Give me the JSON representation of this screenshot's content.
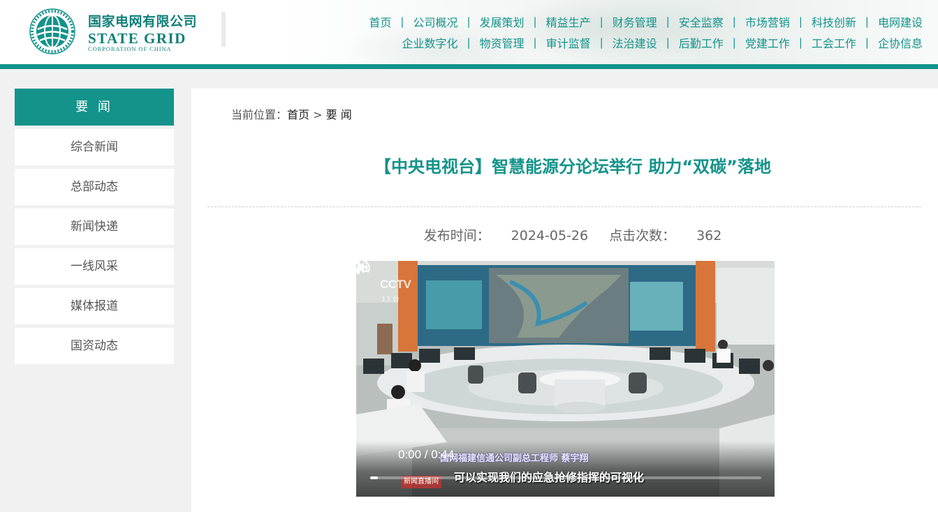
{
  "brand": {
    "name_cn": "国家电网有限公司",
    "name_en": "STATE GRID",
    "name_en_sub": "CORPORATION OF CHINA",
    "logo_text": "国家电网公司 · STATE GRID CORPORATION OF CHINA"
  },
  "nav": {
    "row1": [
      "首页",
      "公司概况",
      "发展策划",
      "精益生产",
      "财务管理",
      "安全监察",
      "市场营销",
      "科技创新",
      "电网建设"
    ],
    "row2": [
      "企业数字化",
      "物资管理",
      "审计监督",
      "法治建设",
      "后勤工作",
      "党建工作",
      "工会工作",
      "企协信息"
    ],
    "separator": "|"
  },
  "sidebar": {
    "heading": "要 闻",
    "items": [
      {
        "label": "综合新闻"
      },
      {
        "label": "总部动态"
      },
      {
        "label": "新闻快递"
      },
      {
        "label": "一线风采"
      },
      {
        "label": "媒体报道"
      },
      {
        "label": "国资动态"
      }
    ]
  },
  "breadcrumb": {
    "prefix": "当前位置：",
    "home": "首页",
    "sep": " > ",
    "current": "要 闻"
  },
  "article": {
    "title": "【中央电视台】智慧能源分论坛举行 助力“双碳”落地",
    "publish_label": "发布时间：",
    "publish_date": "2024-05-26",
    "clicks_label": "点击次数：",
    "clicks": "362"
  },
  "video": {
    "time": "0:00 / 0:44",
    "progress_fraction": 0.02,
    "watermark": "CCTV",
    "watermark_sub": "13 台",
    "caption_speaker": "国网福建信通公司副总工程师 蔡宇翔",
    "caption_line": "可以实现我们的应急抢修指挥的可视化",
    "news_tag": "新闻直播间"
  },
  "colors": {
    "brand_teal": "#13938a",
    "page_bg": "#f1f1f1",
    "panel_bg": "#ffffff"
  }
}
